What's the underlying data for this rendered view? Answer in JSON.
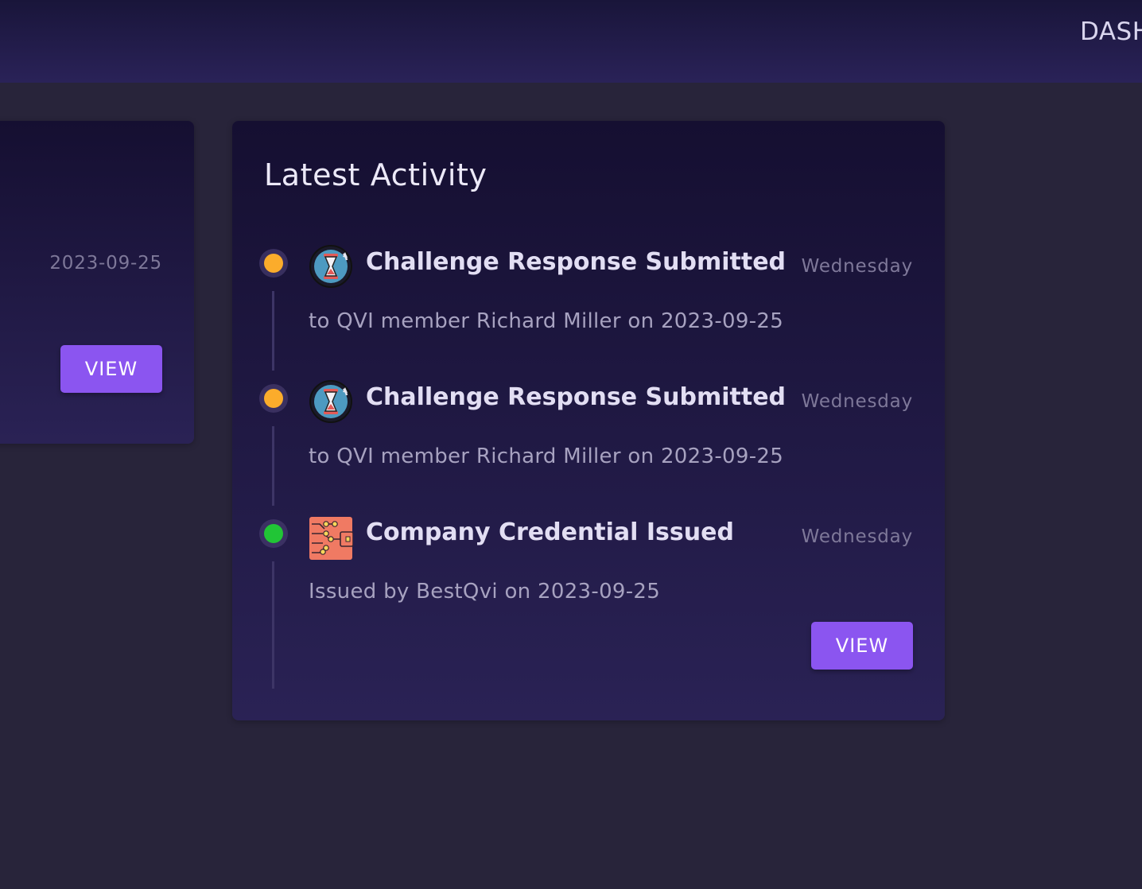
{
  "header": {
    "nav_label": "DASH"
  },
  "left_card": {
    "date": "2023-09-25",
    "view_label": "VIEW"
  },
  "activity": {
    "title": "Latest Activity",
    "items": [
      {
        "title": "Challenge Response Submitted",
        "day": "Wednesday",
        "description": "to QVI member Richard Miller on 2023-09-25",
        "status_color": "#fbac2b",
        "icon": "hourglass-icon"
      },
      {
        "title": "Challenge Response Submitted",
        "day": "Wednesday",
        "description": "to QVI member Richard Miller on 2023-09-25",
        "status_color": "#fbac2b",
        "icon": "hourglass-icon"
      },
      {
        "title": "Company Credential Issued",
        "day": "Wednesday",
        "description": "Issued by BestQvi on 2023-09-25",
        "status_color": "#21c536",
        "icon": "credential-wallet-icon"
      }
    ],
    "view_label": "VIEW"
  },
  "colors": {
    "accent": "#8b55f0",
    "background": "#28243a",
    "card_top": "#150f31",
    "card_bottom": "#2a2255"
  }
}
